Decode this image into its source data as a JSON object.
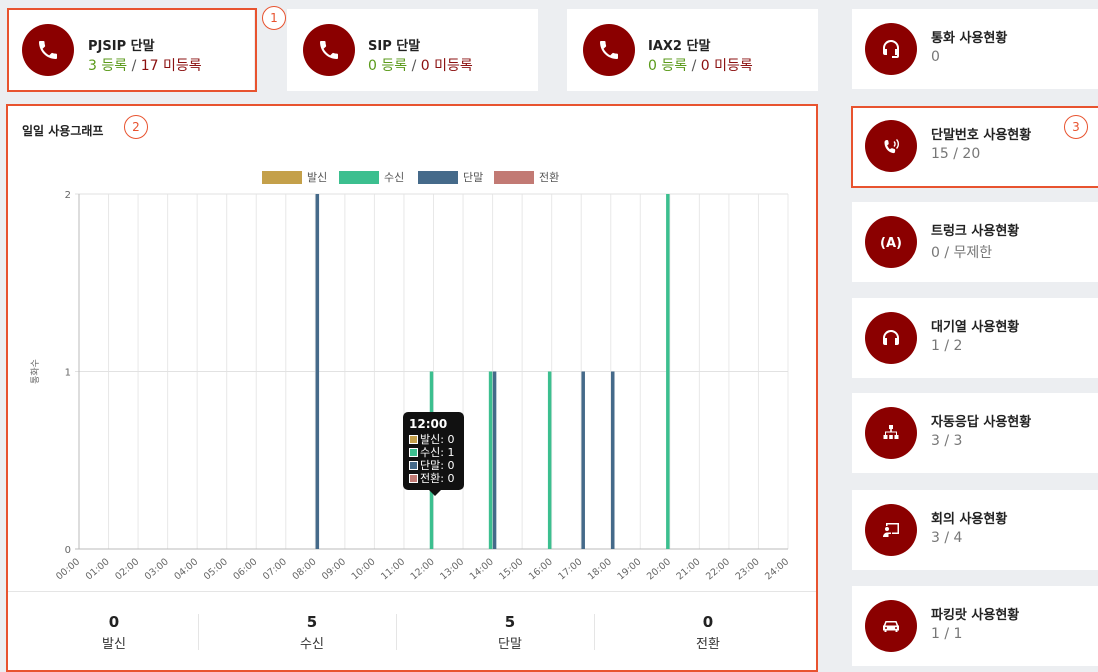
{
  "terminals": [
    {
      "title": "PJSIP 단말",
      "registered": "3 등록",
      "unregistered": "17 미등록"
    },
    {
      "title": "SIP 단말",
      "registered": "0 등록",
      "unregistered": "0 미등록"
    },
    {
      "title": "IAX2 단말",
      "registered": "0 등록",
      "unregistered": "0 미등록"
    }
  ],
  "separator": " / ",
  "badges": [
    "1",
    "2",
    "3"
  ],
  "side_items": [
    {
      "title": "통화 사용현황",
      "value": "0",
      "icon": "headset-icon"
    },
    {
      "title": "단말번호 사용현황",
      "value": "15 / 20",
      "icon": "phone-ringing-icon"
    },
    {
      "title": "트렁크 사용현황",
      "value": "0 / 무제한",
      "icon": "antenna-icon"
    },
    {
      "title": "대기열 사용현황",
      "value": "1 / 2",
      "icon": "headphones-icon"
    },
    {
      "title": "자동응답 사용현황",
      "value": "3 / 3",
      "icon": "org-chart-icon"
    },
    {
      "title": "회의 사용현황",
      "value": "3 / 4",
      "icon": "presentation-icon"
    },
    {
      "title": "파킹랏 사용현황",
      "value": "1 / 1",
      "icon": "car-icon"
    }
  ],
  "graph": {
    "title": "일일 사용그래프",
    "summary": [
      {
        "value": "0",
        "label": "발신"
      },
      {
        "value": "5",
        "label": "수신"
      },
      {
        "value": "5",
        "label": "단말"
      },
      {
        "value": "0",
        "label": "전환"
      }
    ],
    "tooltip": {
      "title": "12:00",
      "rows": [
        "발신: 0",
        "수신: 1",
        "단말: 0",
        "전환: 0"
      ]
    }
  },
  "colors": {
    "accent": "#8b0000",
    "outgoing": "#c4a04a",
    "incoming": "#3cbf8f",
    "terminal": "#456a8a",
    "transfer": "#c27a74"
  },
  "chart_data": {
    "type": "bar",
    "ylabel": "통화수",
    "ylim": [
      0,
      2
    ],
    "yticks": [
      "0",
      "1",
      "2"
    ],
    "categories": [
      "00:00",
      "01:00",
      "02:00",
      "03:00",
      "04:00",
      "05:00",
      "06:00",
      "07:00",
      "08:00",
      "09:00",
      "10:00",
      "11:00",
      "12:00",
      "13:00",
      "14:00",
      "15:00",
      "16:00",
      "17:00",
      "18:00",
      "19:00",
      "20:00",
      "21:00",
      "22:00",
      "23:00",
      "24:00"
    ],
    "series": [
      {
        "name": "발신",
        "color": "#c4a04a",
        "values": [
          0,
          0,
          0,
          0,
          0,
          0,
          0,
          0,
          0,
          0,
          0,
          0,
          0,
          0,
          0,
          0,
          0,
          0,
          0,
          0,
          0,
          0,
          0,
          0,
          0
        ]
      },
      {
        "name": "수신",
        "color": "#3cbf8f",
        "values": [
          0,
          0,
          0,
          0,
          0,
          0,
          0,
          0,
          0,
          0,
          0,
          0,
          1,
          0,
          1,
          0,
          1,
          0,
          0,
          0,
          2,
          0,
          0,
          0,
          0
        ]
      },
      {
        "name": "단말",
        "color": "#456a8a",
        "values": [
          0,
          0,
          0,
          0,
          0,
          0,
          0,
          0,
          2,
          0,
          0,
          0,
          0,
          0,
          1,
          0,
          0,
          1,
          1,
          0,
          0,
          0,
          0,
          0,
          0
        ]
      },
      {
        "name": "전환",
        "color": "#c27a74",
        "values": [
          0,
          0,
          0,
          0,
          0,
          0,
          0,
          0,
          0,
          0,
          0,
          0,
          0,
          0,
          0,
          0,
          0,
          0,
          0,
          0,
          0,
          0,
          0,
          0,
          0
        ]
      }
    ],
    "legend": "top"
  }
}
